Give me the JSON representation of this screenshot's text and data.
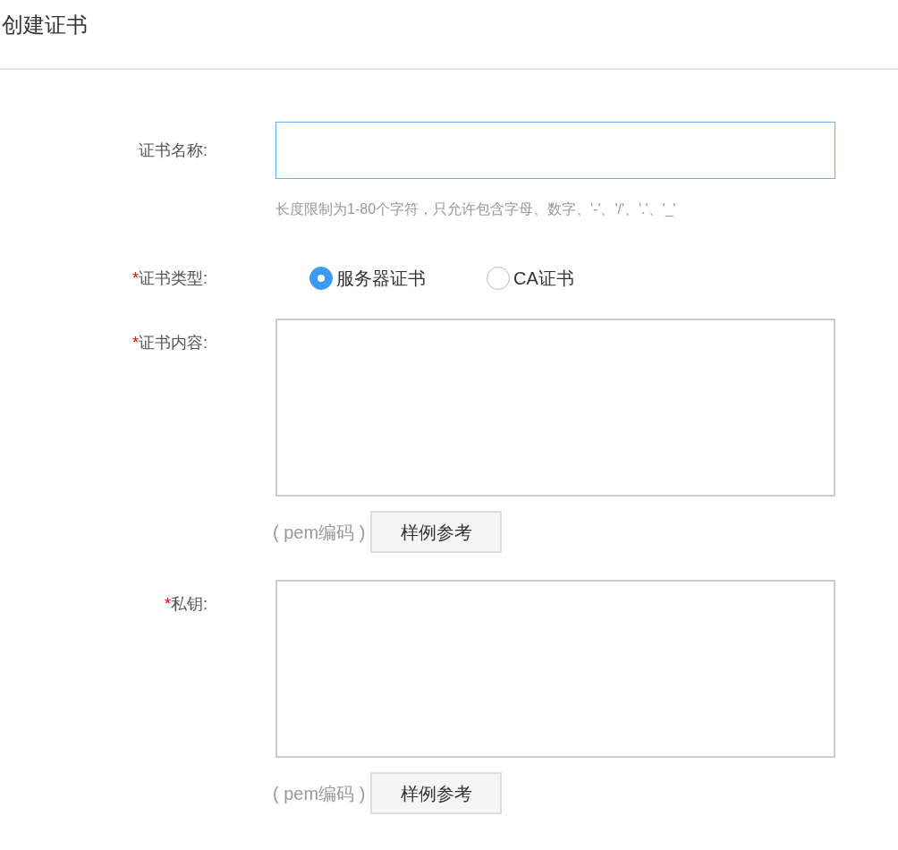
{
  "title": "创建证书",
  "form": [
    {
      "kind": "text",
      "label": "证书名称:",
      "focused": true,
      "hint": "长度限制为1-80个字符，只允许包含字母、数字、'-'、'/'、'.'、'_'"
    },
    {
      "kind": "radio",
      "required_mark": "*",
      "label": "证书类型:",
      "options": [
        {
          "label": "服务器证书",
          "selected": true
        },
        {
          "label": "CA证书",
          "selected": false
        }
      ]
    },
    {
      "kind": "textarea",
      "required_mark": "*",
      "label": "证书内容:",
      "note": "( pem编码 )",
      "button": "样例参考"
    },
    {
      "kind": "textarea",
      "required_mark": "*",
      "label": "私钥:",
      "note": "( pem编码 )",
      "button": "样例参考"
    }
  ]
}
